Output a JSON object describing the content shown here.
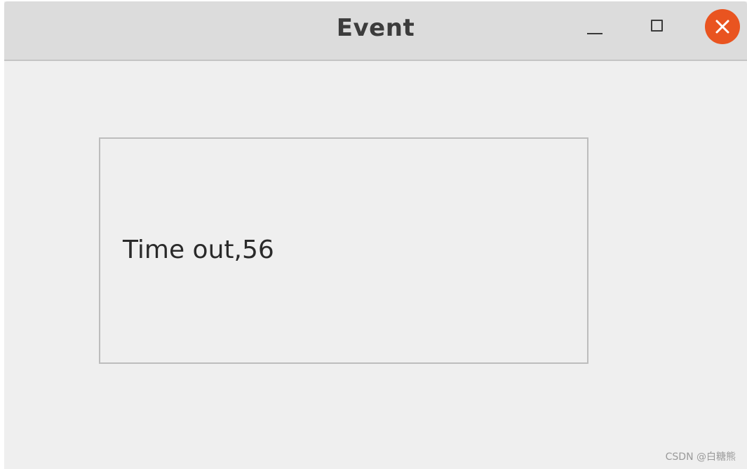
{
  "window": {
    "title": "Event",
    "controls": {
      "minimize_icon": "minimize-icon",
      "maximize_icon": "maximize-icon",
      "close_icon": "close-icon",
      "close_color": "#e95420"
    }
  },
  "main": {
    "label_text": "Time out,56"
  },
  "watermark": {
    "text": "CSDN @白糖熊"
  }
}
